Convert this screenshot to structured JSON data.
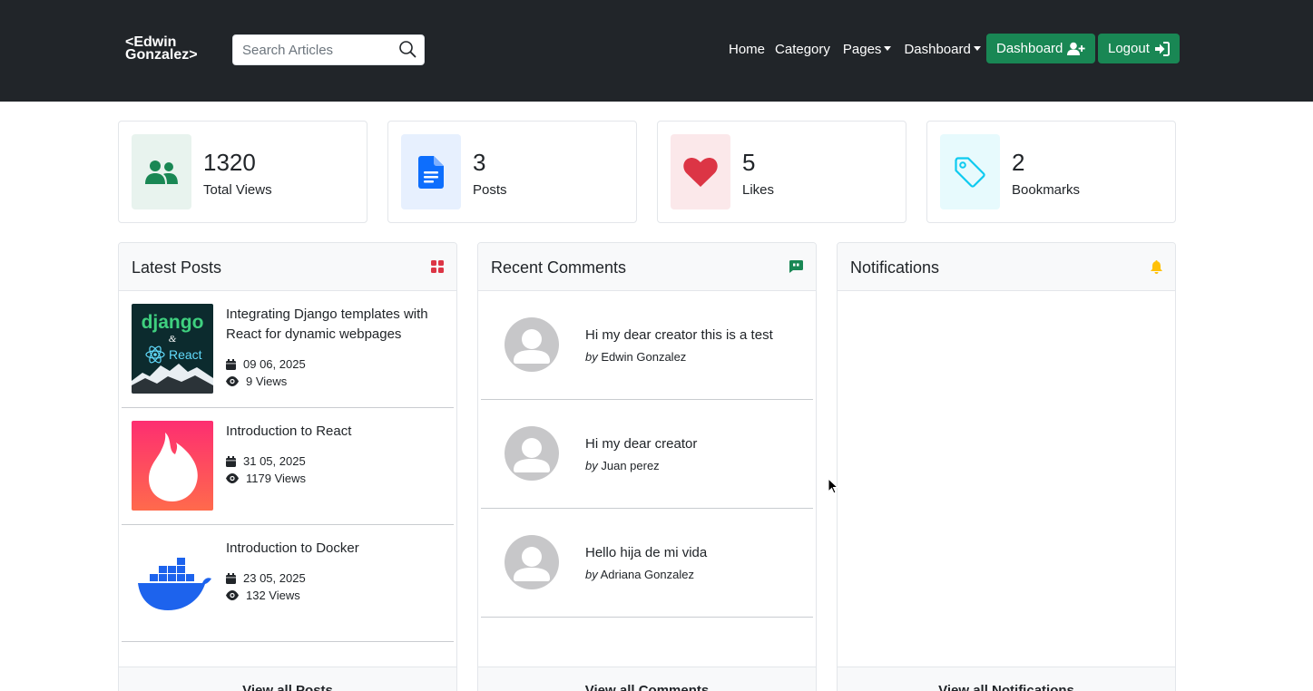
{
  "brand": {
    "line1": "<Edwin",
    "line2": "Gonzalez>"
  },
  "search": {
    "placeholder": "Search Articles",
    "icon": "search-icon"
  },
  "nav": {
    "home": "Home",
    "category": "Category",
    "pages": "Pages",
    "dashboard": "Dashboard",
    "dashboard_button": "Dashboard",
    "logout_button": "Logout"
  },
  "stats": [
    {
      "value": "1320",
      "label": "Total Views",
      "icon": "users-icon",
      "bg": "#e8f3ee",
      "color": "#198754"
    },
    {
      "value": "3",
      "label": "Posts",
      "icon": "document-icon",
      "bg": "#e7f0fe",
      "color": "#0d6efd"
    },
    {
      "value": "5",
      "label": "Likes",
      "icon": "heart-icon",
      "bg": "#fbe8ea",
      "color": "#dc3545"
    },
    {
      "value": "2",
      "label": "Bookmarks",
      "icon": "tag-icon",
      "bg": "#e7fafd",
      "color": "#0dcaf0"
    }
  ],
  "latest_posts": {
    "title": "Latest Posts",
    "footer": "View all Posts",
    "items": [
      {
        "title": "Integrating Django templates with React for dynamic webpages",
        "date": "09 06, 2025",
        "views": "9 Views",
        "thumb": "django-react-image"
      },
      {
        "title": "Introduction to React",
        "date": "31 05, 2025",
        "views": "1179 Views",
        "thumb": "flame-logo-image"
      },
      {
        "title": "Introduction to Docker",
        "date": "23 05, 2025",
        "views": "132 Views",
        "thumb": "docker-logo-image"
      }
    ]
  },
  "recent_comments": {
    "title": "Recent Comments",
    "footer": "View all Comments",
    "by_prefix": "by",
    "items": [
      {
        "text": "Hi my dear creator this is a test",
        "author": "Edwin Gonzalez"
      },
      {
        "text": "Hi my dear creator",
        "author": "Juan perez"
      },
      {
        "text": "Hello hija de mi vida",
        "author": "Adriana Gonzalez"
      }
    ]
  },
  "notifications": {
    "title": "Notifications",
    "footer": "View all Notifications"
  },
  "thumb_text": {
    "django": "django",
    "amp": "&",
    "react": "React"
  }
}
